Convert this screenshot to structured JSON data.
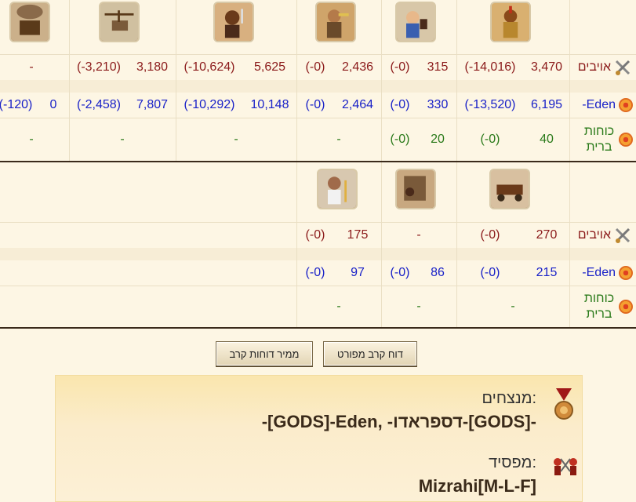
{
  "colors": {
    "enemy": "#8b1a1a",
    "player": "#1a22c8",
    "ally": "#2a7a1a"
  },
  "icons": {
    "enemy": "crossed-swords-icon",
    "player": "target-badge-icon",
    "ally": "target-badge-icon",
    "winners": "medal-icon",
    "loser": "fighters-icon"
  },
  "table1": {
    "rows": {
      "enemies": {
        "label": "אויבים",
        "cells": [
          "3,470",
          "(-14,016)",
          "315",
          "(-0)",
          "2,436",
          "(-0)",
          "5,625",
          "(-10,624)",
          "3,180",
          "(-3,210)",
          "-"
        ]
      },
      "eden": {
        "label": "-Eden",
        "cells": [
          "6,195",
          "(-13,520)",
          "330",
          "(-0)",
          "2,464",
          "(-0)",
          "10,148",
          "(-10,292)",
          "7,807",
          "(-2,458)",
          "0",
          "(-120)"
        ]
      },
      "allies": {
        "label": "כוחות ברית",
        "cells": [
          "40",
          "(-0)",
          "20",
          "(-0)",
          "-",
          "-",
          "-",
          "-"
        ]
      }
    }
  },
  "table2": {
    "rows": {
      "enemies": {
        "label": "אויבים",
        "cells": [
          "270",
          "(-0)",
          "-",
          "175",
          "(-0)"
        ]
      },
      "eden": {
        "label": "-Eden",
        "cells": [
          "215",
          "(-0)",
          "86",
          "(-0)",
          "97",
          "(-0)"
        ]
      },
      "allies": {
        "label": "כוחות ברית",
        "cells": [
          "-",
          "-",
          "-"
        ]
      }
    }
  },
  "buttons": {
    "detailed": "דוח קרב מפורט",
    "converter": "ממיר דוחות קרב"
  },
  "summary": {
    "winners_label": "מנצחים:",
    "winners_value": "-[GODS]-Eden, -דספראדו-[GODS]-",
    "loser_label": "מפסיד:",
    "loser_value": "Mizrahi[M-L-F]"
  }
}
